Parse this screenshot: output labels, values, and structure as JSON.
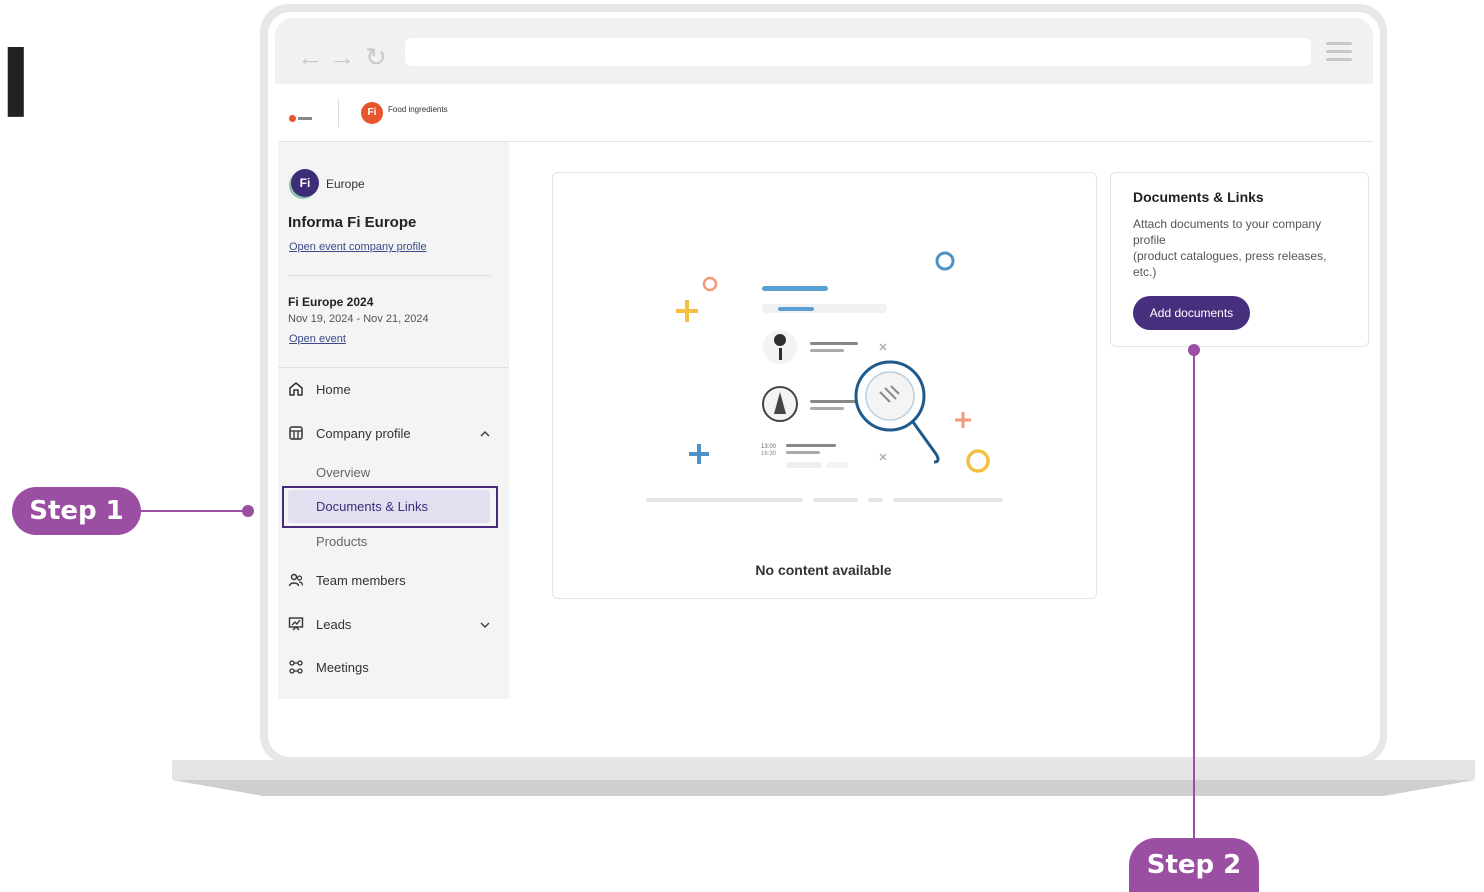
{
  "frame_title": "l",
  "brand": {
    "fi_badge": "Fi",
    "food_ingredients": "Food ingredients"
  },
  "sidebar": {
    "region": "Europe",
    "company_name": "Informa Fi Europe",
    "company_link": "Open event company profile",
    "event_name": "Fi Europe 2024",
    "event_dates": "Nov 19, 2024 - Nov 21, 2024",
    "event_link": "Open event",
    "nav": {
      "home": "Home",
      "company_profile": "Company profile",
      "overview": "Overview",
      "documents_links": "Documents & Links",
      "products": "Products",
      "team_members": "Team members",
      "leads": "Leads",
      "meetings": "Meetings"
    }
  },
  "main": {
    "empty_state": "No content available",
    "illustration_times": [
      "13:00",
      "16:30"
    ]
  },
  "side_card": {
    "title": "Documents & Links",
    "description": "Attach documents to your company profile\n(product catalogues, press releases, etc.)",
    "button": "Add documents"
  },
  "callouts": {
    "step1": "Step 1",
    "step2": "Step 2"
  },
  "colors": {
    "accent_purple": "#46307e",
    "callout_purple": "#9b4fa3",
    "brand_orange": "#e8542c"
  }
}
